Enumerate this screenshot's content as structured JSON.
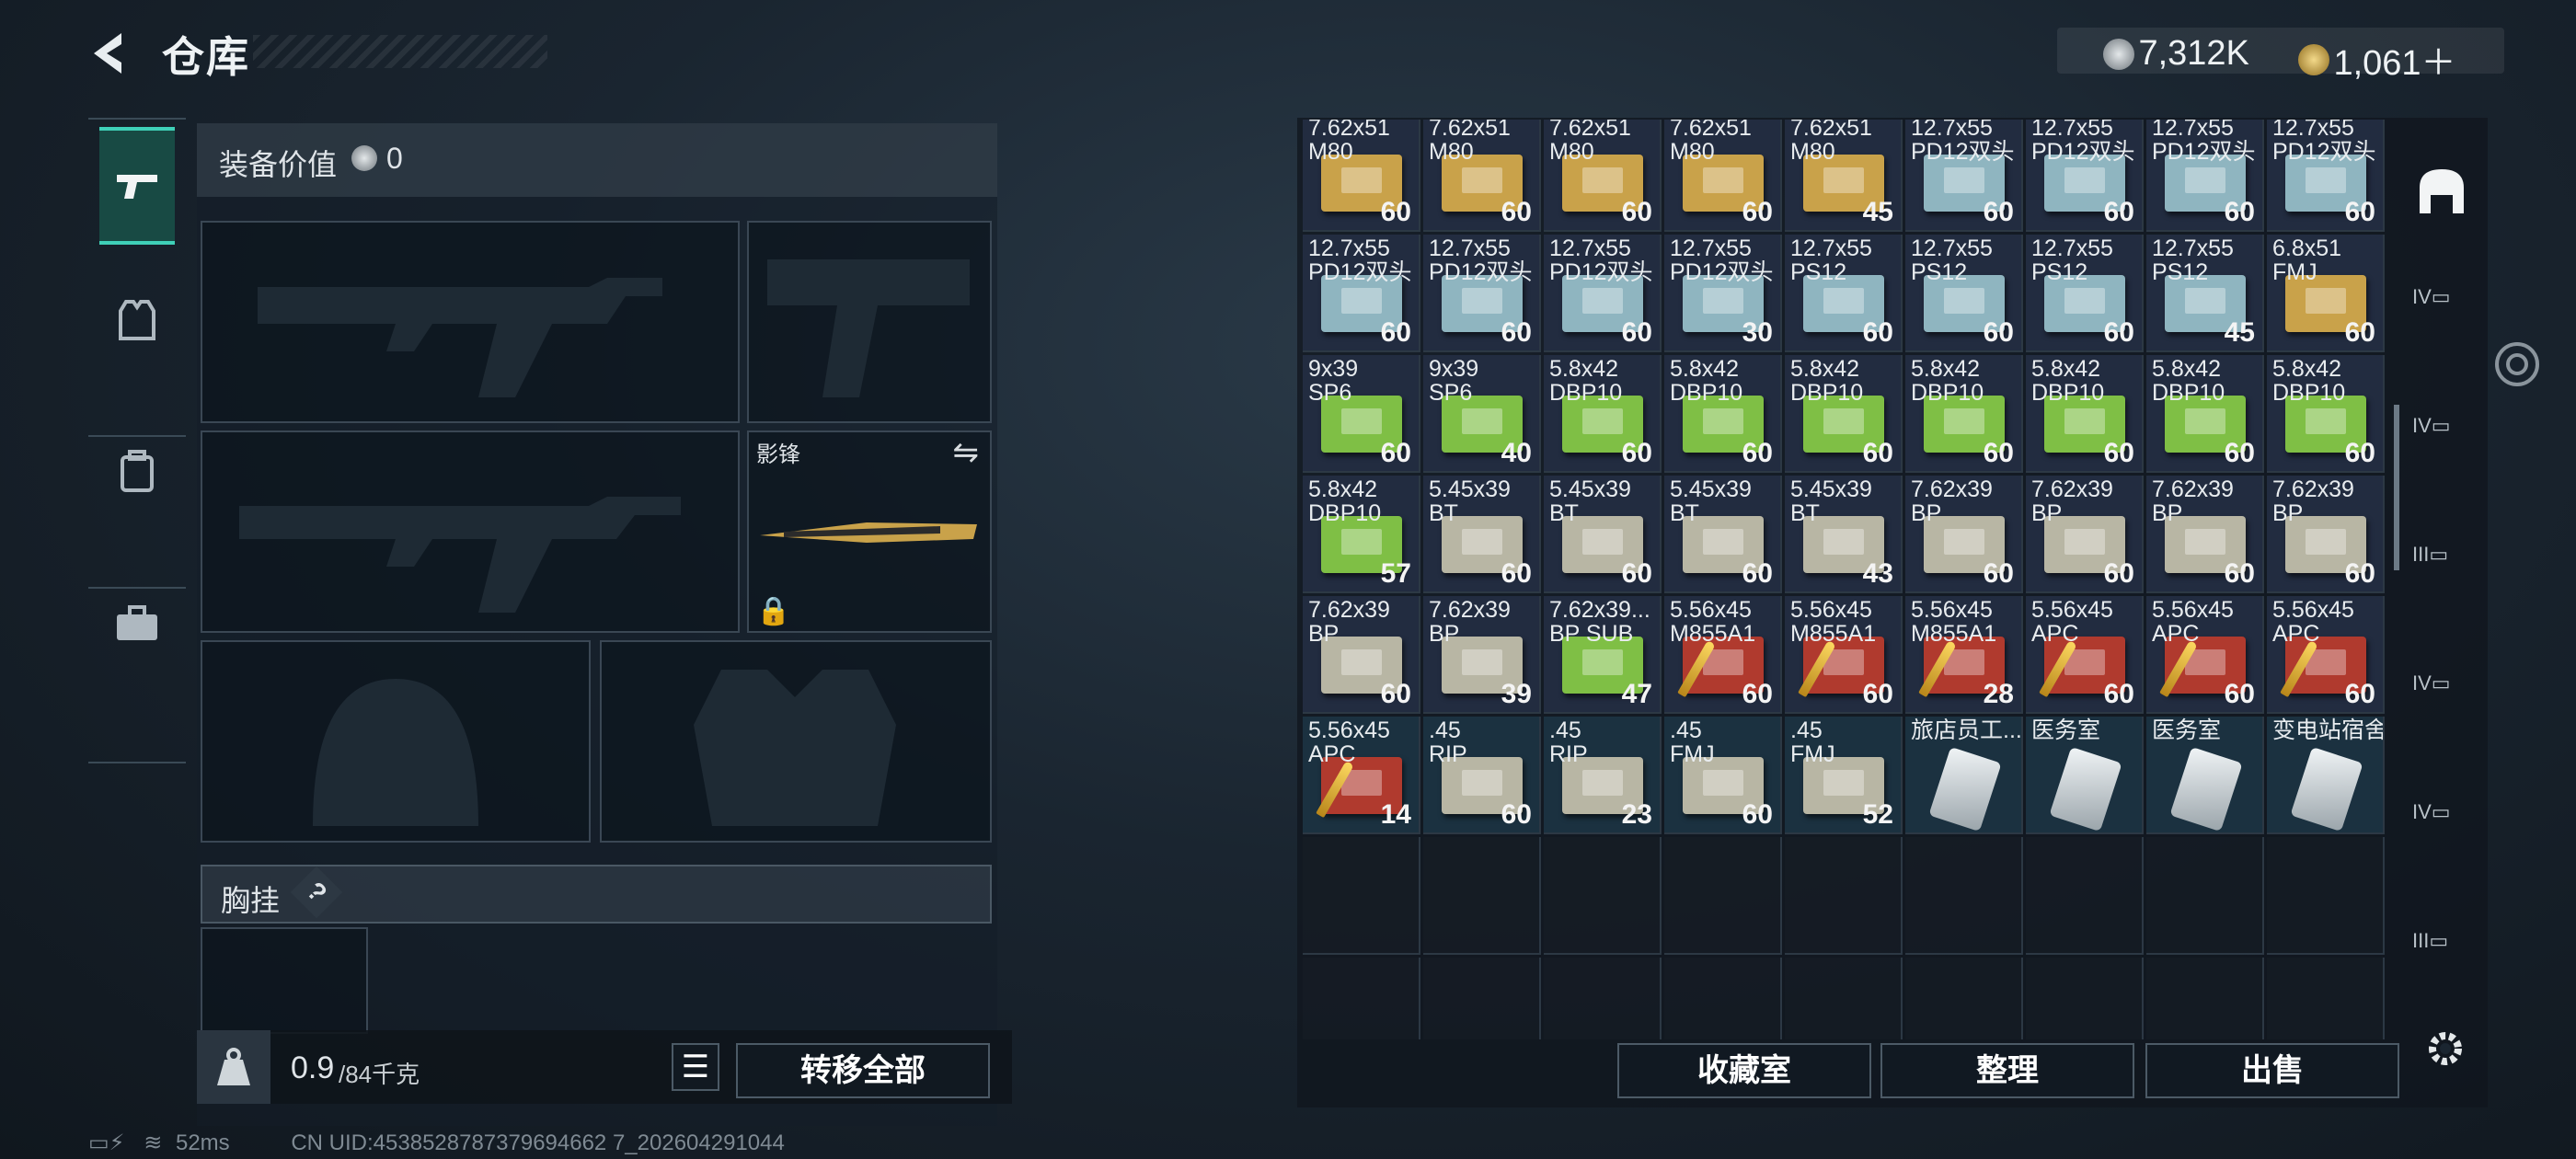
{
  "header": {
    "title": "仓库"
  },
  "currency": {
    "coin1": "7,312K",
    "coin2": "1,061＋"
  },
  "equipment": {
    "value_label": "装备价值",
    "value": "0",
    "melee_name": "影锋",
    "chest_rig_label": "胸挂",
    "chest_help": "?"
  },
  "bottom_left": {
    "weight": "0.9",
    "weight_max": "/84千克",
    "transfer_all": "转移全部"
  },
  "stash_buttons": {
    "collection": "收藏室",
    "organize": "整理",
    "sell": "出售"
  },
  "status": {
    "ping": "52ms",
    "uid": "CN UID:4538528787379694662 7_202604291044"
  },
  "colors": {
    "accent": "#3fd0b8",
    "ammo_tan": "#c9a24a",
    "ammo_blue": "#8fb5c0",
    "ammo_green": "#7fbf45",
    "ammo_gray": "#b8b6a4",
    "ammo_red": "#b03a2e"
  },
  "stash_rows": [
    [
      {
        "n": "7.62x51\nM80",
        "q": "60",
        "c": "tan"
      },
      {
        "n": "7.62x51\nM80",
        "q": "60",
        "c": "tan"
      },
      {
        "n": "7.62x51\nM80",
        "q": "60",
        "c": "tan"
      },
      {
        "n": "7.62x51\nM80",
        "q": "60",
        "c": "tan"
      },
      {
        "n": "7.62x51\nM80",
        "q": "45",
        "c": "tan"
      },
      {
        "n": "12.7x55\nPD12双头",
        "q": "60",
        "c": "blue"
      },
      {
        "n": "12.7x55\nPD12双头",
        "q": "60",
        "c": "blue"
      },
      {
        "n": "12.7x55\nPD12双头",
        "q": "60",
        "c": "blue"
      },
      {
        "n": "12.7x55\nPD12双头",
        "q": "60",
        "c": "blue"
      }
    ],
    [
      {
        "n": "12.7x55\nPD12双头",
        "q": "60",
        "c": "blue"
      },
      {
        "n": "12.7x55\nPD12双头",
        "q": "60",
        "c": "blue"
      },
      {
        "n": "12.7x55\nPD12双头",
        "q": "60",
        "c": "blue"
      },
      {
        "n": "12.7x55\nPD12双头",
        "q": "30",
        "c": "blue"
      },
      {
        "n": "12.7x55\nPS12",
        "q": "60",
        "c": "blue"
      },
      {
        "n": "12.7x55\nPS12",
        "q": "60",
        "c": "blue"
      },
      {
        "n": "12.7x55\nPS12",
        "q": "60",
        "c": "blue"
      },
      {
        "n": "12.7x55\nPS12",
        "q": "45",
        "c": "blue"
      },
      {
        "n": "6.8x51\nFMJ",
        "q": "60",
        "c": "tan"
      }
    ],
    [
      {
        "n": "9x39\nSP6",
        "q": "60",
        "c": "green"
      },
      {
        "n": "9x39\nSP6",
        "q": "40",
        "c": "green"
      },
      {
        "n": "5.8x42\nDBP10",
        "q": "60",
        "c": "green"
      },
      {
        "n": "5.8x42\nDBP10",
        "q": "60",
        "c": "green"
      },
      {
        "n": "5.8x42\nDBP10",
        "q": "60",
        "c": "green"
      },
      {
        "n": "5.8x42\nDBP10",
        "q": "60",
        "c": "green"
      },
      {
        "n": "5.8x42\nDBP10",
        "q": "60",
        "c": "green"
      },
      {
        "n": "5.8x42\nDBP10",
        "q": "60",
        "c": "green"
      },
      {
        "n": "5.8x42\nDBP10",
        "q": "60",
        "c": "green"
      }
    ],
    [
      {
        "n": "5.8x42\nDBP10",
        "q": "57",
        "c": "green"
      },
      {
        "n": "5.45x39\nBT",
        "q": "60",
        "c": "gray"
      },
      {
        "n": "5.45x39\nBT",
        "q": "60",
        "c": "gray"
      },
      {
        "n": "5.45x39\nBT",
        "q": "60",
        "c": "gray"
      },
      {
        "n": "5.45x39\nBT",
        "q": "43",
        "c": "gray"
      },
      {
        "n": "7.62x39\nBP",
        "q": "60",
        "c": "gray"
      },
      {
        "n": "7.62x39\nBP",
        "q": "60",
        "c": "gray"
      },
      {
        "n": "7.62x39\nBP",
        "q": "60",
        "c": "gray"
      },
      {
        "n": "7.62x39\nBP",
        "q": "60",
        "c": "gray"
      }
    ],
    [
      {
        "n": "7.62x39\nBP",
        "q": "60",
        "c": "gray"
      },
      {
        "n": "7.62x39\nBP",
        "q": "39",
        "c": "gray"
      },
      {
        "n": "7.62x39...\nBP SUB",
        "q": "47",
        "c": "green"
      },
      {
        "n": "5.56x45\nM855A1",
        "q": "60",
        "c": "red"
      },
      {
        "n": "5.56x45\nM855A1",
        "q": "60",
        "c": "red"
      },
      {
        "n": "5.56x45\nM855A1",
        "q": "28",
        "c": "red"
      },
      {
        "n": "5.56x45\nAPC",
        "q": "60",
        "c": "red"
      },
      {
        "n": "5.56x45\nAPC",
        "q": "60",
        "c": "red"
      },
      {
        "n": "5.56x45\nAPC",
        "q": "60",
        "c": "red"
      }
    ],
    [
      {
        "n": "5.56x45\nAPC",
        "q": "14",
        "c": "red"
      },
      {
        "n": ".45\nRIP",
        "q": "60",
        "c": "gray"
      },
      {
        "n": ".45\nRIP",
        "q": "23",
        "c": "gray"
      },
      {
        "n": ".45\nFMJ",
        "q": "60",
        "c": "gray"
      },
      {
        "n": ".45\nFMJ",
        "q": "52",
        "c": "gray"
      },
      {
        "n": "旅店员工...",
        "q": "",
        "c": "pack"
      },
      {
        "n": "医务室",
        "q": "",
        "c": "pack"
      },
      {
        "n": "医务室",
        "q": "",
        "c": "pack"
      },
      {
        "n": "变电站宿舍",
        "q": "",
        "c": "pack"
      }
    ]
  ]
}
